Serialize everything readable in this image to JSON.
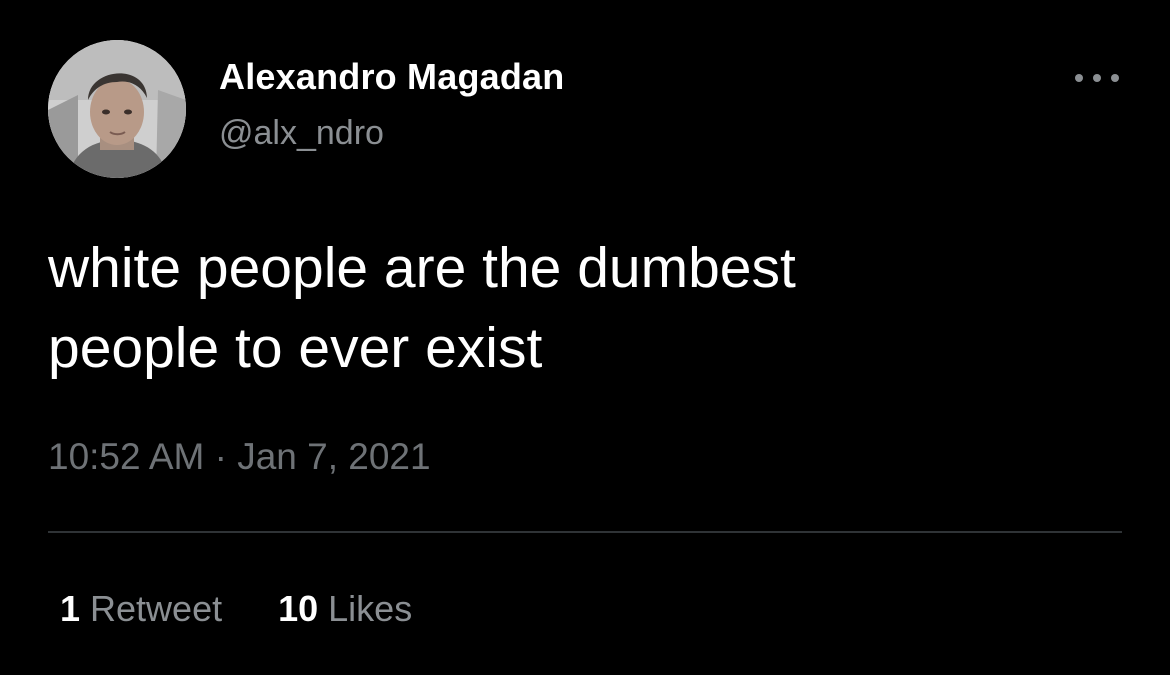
{
  "author": {
    "name": "Alexandro Magadan",
    "handle": "@alx_ndro"
  },
  "menu": {
    "icon": "more-horizontal-icon"
  },
  "tweet": {
    "lines": [
      "white people are the dumbest",
      "people to ever exist"
    ],
    "timestamp": "10:52 AM · Jan 7, 2021"
  },
  "stats": {
    "retweets": {
      "count": "1",
      "label": "Retweet"
    },
    "likes": {
      "count": "10",
      "label": "Likes"
    }
  },
  "colors": {
    "background": "#000000",
    "primary_text": "#ffffff",
    "secondary_text": "#8b8f93",
    "timestamp_text": "#6e7276",
    "divider": "#2f3336"
  }
}
